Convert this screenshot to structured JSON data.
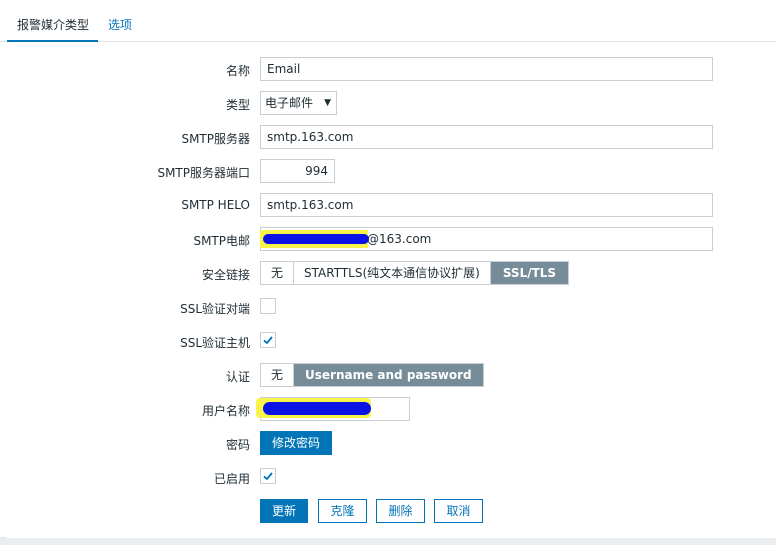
{
  "tabs": [
    {
      "label": "报警媒介类型",
      "active": true
    },
    {
      "label": "选项",
      "active": false
    }
  ],
  "form": {
    "name": {
      "label": "名称",
      "value": "Email"
    },
    "type": {
      "label": "类型",
      "value": "电子邮件"
    },
    "smtp_server": {
      "label": "SMTP服务器",
      "value": "smtp.163.com"
    },
    "smtp_port": {
      "label": "SMTP服务器端口",
      "value": "994"
    },
    "smtp_helo": {
      "label": "SMTP HELO",
      "value": "smtp.163.com"
    },
    "smtp_email": {
      "label": "SMTP电邮",
      "value_visible_suffix": "@163.com"
    },
    "security": {
      "label": "安全链接",
      "options": [
        "无",
        "STARTTLS(纯文本通信协议扩展)",
        "SSL/TLS"
      ],
      "selected": "SSL/TLS"
    },
    "ssl_verify_peer": {
      "label": "SSL验证对端",
      "checked": false
    },
    "ssl_verify_host": {
      "label": "SSL验证主机",
      "checked": true
    },
    "auth": {
      "label": "认证",
      "options": [
        "无",
        "Username and password"
      ],
      "selected": "Username and password"
    },
    "username": {
      "label": "用户名称"
    },
    "password": {
      "label": "密码",
      "button": "修改密码"
    },
    "enabled": {
      "label": "已启用",
      "checked": true
    }
  },
  "actions": {
    "update": "更新",
    "clone": "克隆",
    "delete": "删除",
    "cancel": "取消"
  },
  "colors": {
    "accent": "#0275b8",
    "segment_selected": "#768d99",
    "redaction": "#0a12e6",
    "highlight": "#f7f34a"
  }
}
